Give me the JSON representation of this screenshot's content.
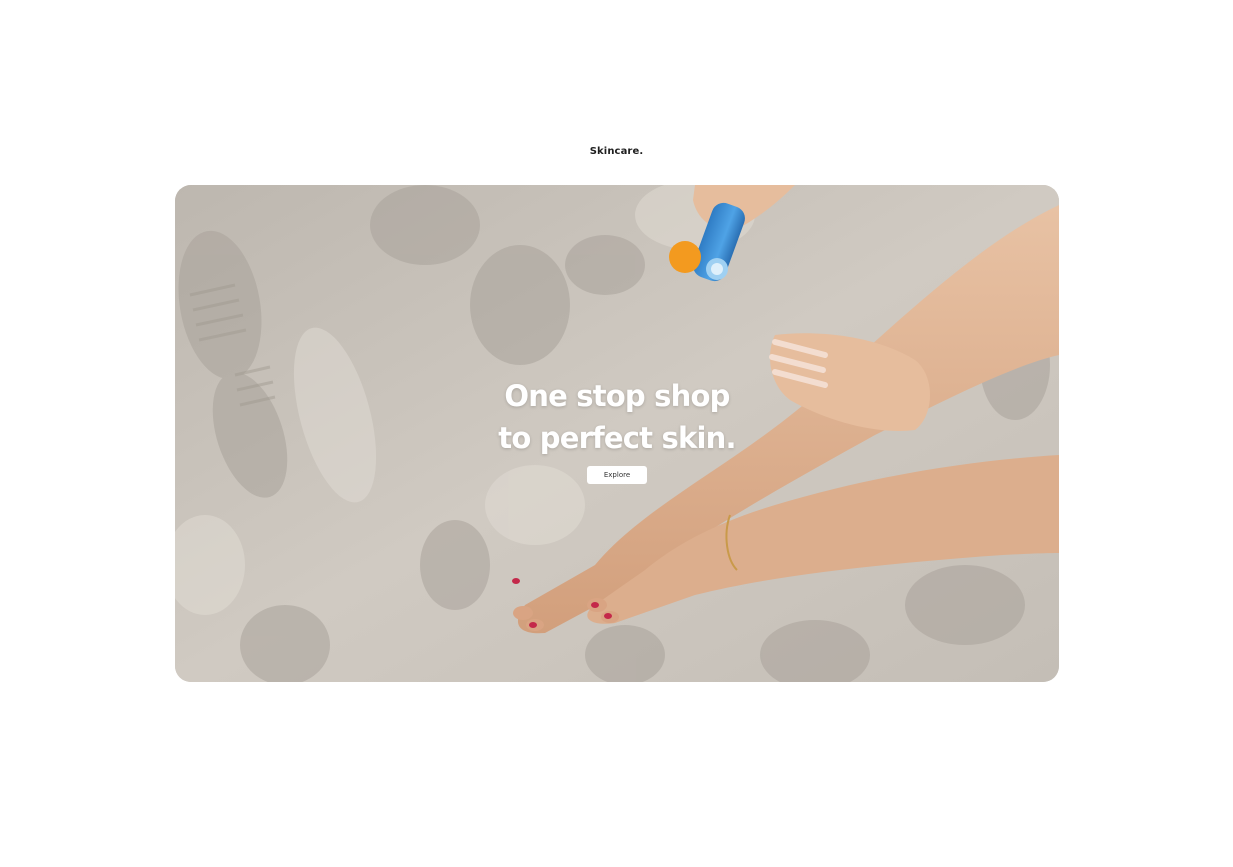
{
  "brand": {
    "name": "Skincare."
  },
  "hero": {
    "headline_line1": "One stop shop",
    "headline_line2": "to perfect skin.",
    "cta_label": "Explore",
    "image_alt": "Person applying sunscreen on legs while sitting on sand"
  },
  "colors": {
    "background": "#ffffff",
    "sand": "#c9c3bb",
    "bottle": "#3d8fd6",
    "cap": "#f39a1f",
    "skin": "#e2b595",
    "text_on_image": "#ffffff"
  }
}
